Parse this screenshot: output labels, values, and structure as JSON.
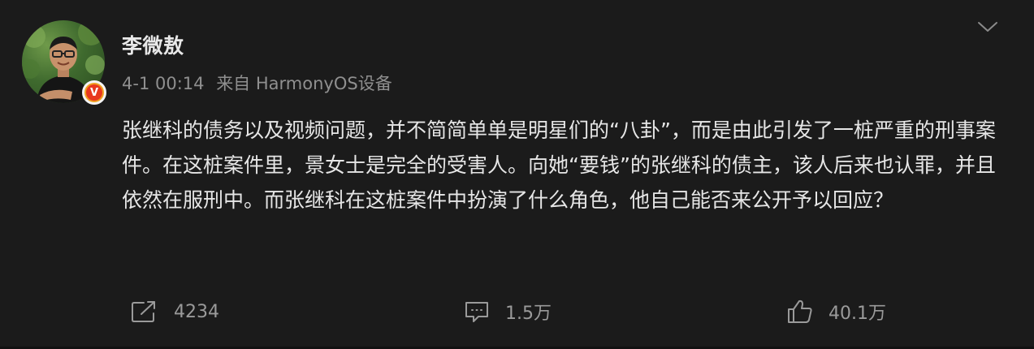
{
  "post": {
    "author": "李微敖",
    "time": "4-1 00:14",
    "source": "来自 HarmonyOS设备",
    "verified_badge": "V",
    "text": "张继科的债务以及视频问题，并不简简单单是明星们的“八卦”，而是由此引发了一桩严重的刑事案件。在这桩案件里，景女士是完全的受害人。向她“要钱”的张继科的债主，该人后来也认罪，并且依然在服刑中。而张继科在这桩案件中扮演了什么角色，他自己能否来公开予以回应？"
  },
  "actions": {
    "forward": {
      "icon": "share-icon",
      "count": "4234"
    },
    "comment": {
      "icon": "comment-icon",
      "count": "1.5万"
    },
    "like": {
      "icon": "thumbs-up-icon",
      "count": "40.1万"
    }
  },
  "icons": {
    "menu": "chevron-down-icon"
  },
  "colors": {
    "background": "#1b1b1b",
    "text": "#e6e6e6",
    "muted": "#8f8f8f",
    "badge_outer": "#f0a020",
    "badge_inner": "#e8381e"
  }
}
